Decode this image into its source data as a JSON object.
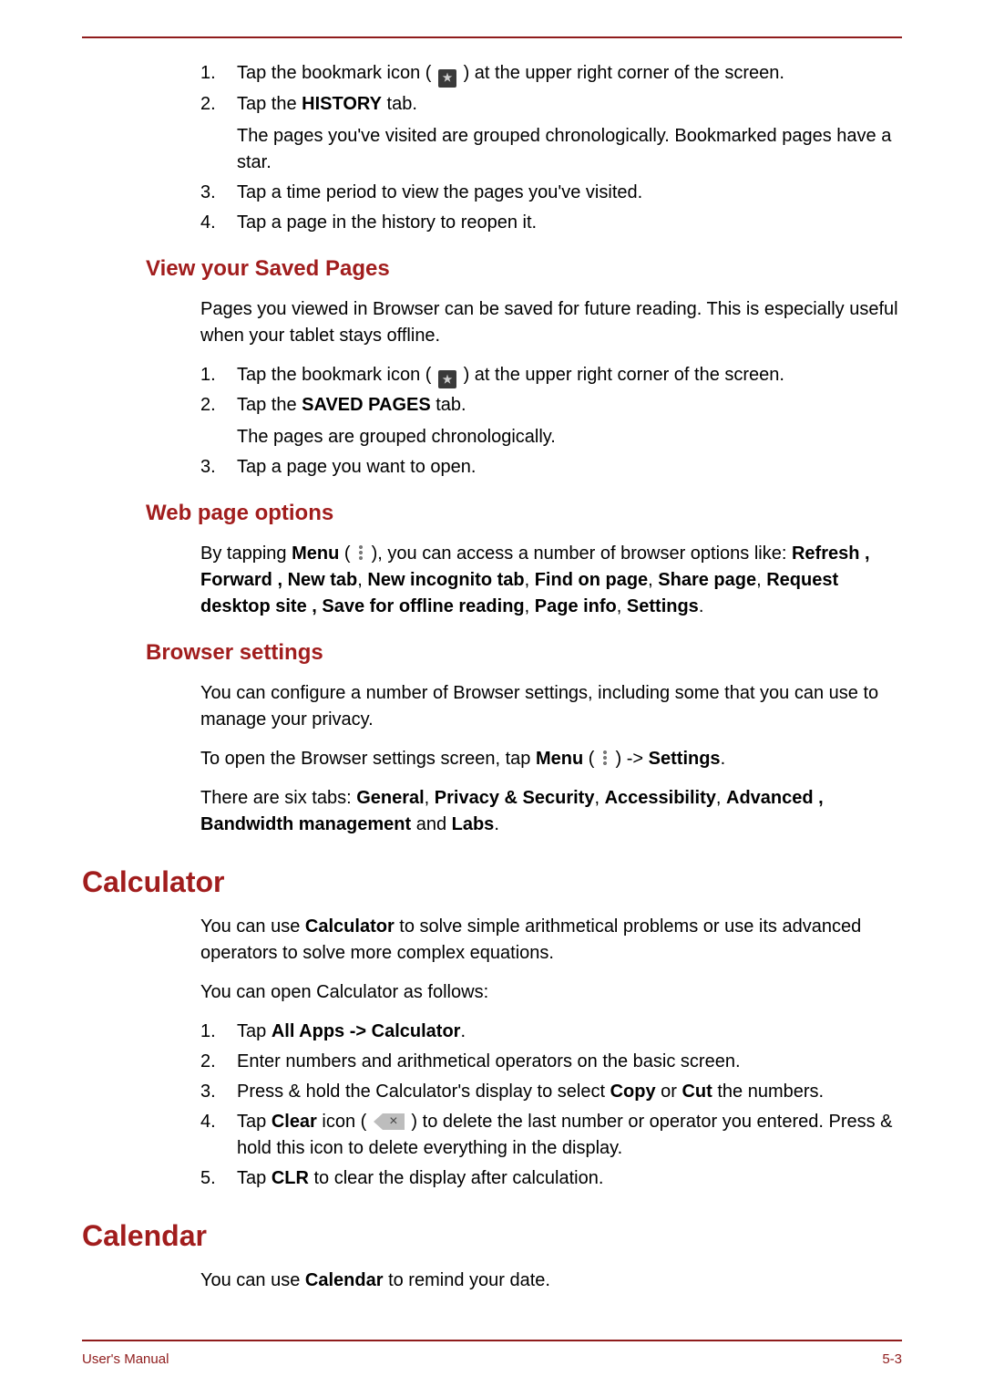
{
  "footer": {
    "left": "User's Manual",
    "right": "5-3"
  },
  "history": {
    "steps": [
      {
        "n": "1.",
        "pre": "Tap the bookmark icon ( ",
        "post": " ) at the upper right corner of the screen."
      },
      {
        "n": "2.",
        "t1": "Tap the ",
        "bold1": "HISTORY",
        "t2": " tab.",
        "sub": "The pages you've visited are grouped chronologically. Bookmarked pages have a star."
      },
      {
        "n": "3.",
        "t": "Tap a time period to view the pages you've visited."
      },
      {
        "n": "4.",
        "t": "Tap a page in the history to reopen it."
      }
    ]
  },
  "saved": {
    "heading": "View your Saved Pages",
    "intro": "Pages you viewed in Browser can be saved for future reading. This is especially useful when your tablet stays offline.",
    "steps": [
      {
        "n": "1.",
        "pre": "Tap the bookmark icon ( ",
        "post": " ) at the upper right corner of the screen."
      },
      {
        "n": "2.",
        "t1": "Tap the ",
        "bold1": "SAVED PAGES",
        "t2": " tab.",
        "sub": "The pages are grouped chronologically."
      },
      {
        "n": "3.",
        "t": "Tap a page you want to open."
      }
    ]
  },
  "webopt": {
    "heading": "Web page options",
    "t1": "By tapping ",
    "bold1": "Menu",
    "t2": " ( ",
    "t3": " ), you can access a number of browser options like: ",
    "bold2": "Refresh , Forward , New tab",
    "t4": ", ",
    "bold3": "New incognito tab",
    "t5": ", ",
    "bold4": "Find on page",
    "t6": ", ",
    "bold5": "Share page",
    "t7": ", ",
    "bold6": "Request desktop site , Save for offline reading",
    "t8": ", ",
    "bold7": "Page info",
    "t9": ", ",
    "bold8": "Settings",
    "t10": "."
  },
  "browser": {
    "heading": "Browser settings",
    "p1": "You can configure a number of Browser settings, including some that you can use to manage your privacy.",
    "p2a": "To open the Browser settings screen, tap ",
    "p2b": "Menu",
    "p2c": " ( ",
    "p2d": " ) -> ",
    "p2e": "Settings",
    "p2f": ".",
    "p3a": "There are six tabs: ",
    "p3b": "General",
    "p3c": ", ",
    "p3d": "Privacy & Security",
    "p3e": ", ",
    "p3f": "Accessibility",
    "p3g": ", ",
    "p3h": "Advanced , Bandwidth management",
    "p3i": " and ",
    "p3j": "Labs",
    "p3k": "."
  },
  "calc": {
    "heading": "Calculator",
    "p1a": "You can use ",
    "p1b": "Calculator",
    "p1c": " to solve simple arithmetical problems or use its advanced operators to solve more complex equations.",
    "p2": "You can open Calculator as follows:",
    "steps": [
      {
        "n": "1.",
        "t1": "Tap ",
        "b1": "All Apps -> Calculator",
        "t2": "."
      },
      {
        "n": "2.",
        "t": "Enter numbers and arithmetical operators on the basic screen."
      },
      {
        "n": "3.",
        "t1": "Press & hold the Calculator's display to select ",
        "b1": "Copy",
        "t2": " or ",
        "b2": "Cut",
        "t3": " the numbers."
      },
      {
        "n": "4.",
        "t1": "Tap ",
        "b1": "Clear",
        "t2": " icon ( ",
        "t3": " ) to delete the last number or operator you entered. Press & hold this icon to delete everything in the display."
      },
      {
        "n": "5.",
        "t1": "Tap ",
        "b1": "CLR",
        "t2": " to clear the display after calculation."
      }
    ]
  },
  "cal": {
    "heading": "Calendar",
    "p1a": "You can use ",
    "p1b": "Calendar",
    "p1c": " to remind your date."
  }
}
